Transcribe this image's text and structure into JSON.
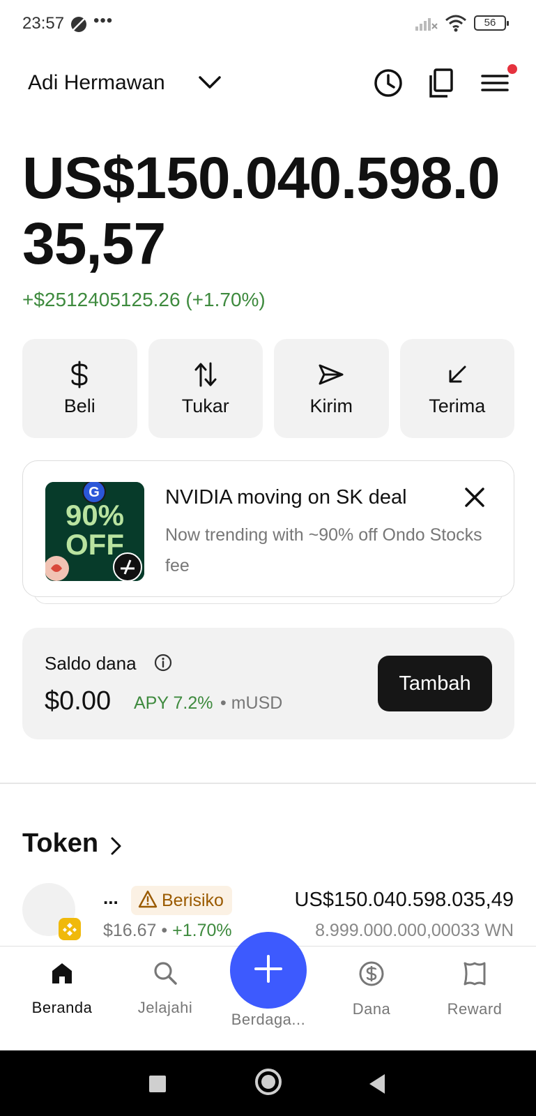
{
  "status_bar": {
    "time": "23:57",
    "extra": "•••",
    "battery": "56"
  },
  "header": {
    "account_name": "Adi Hermawan"
  },
  "portfolio": {
    "balance": "US$150.040.598.035,57",
    "change": "+$2512405125.26 (+1.70%)"
  },
  "actions": [
    {
      "label": "Beli",
      "icon": "dollar-icon"
    },
    {
      "label": "Tukar",
      "icon": "swap-icon"
    },
    {
      "label": "Kirim",
      "icon": "send-icon"
    },
    {
      "label": "Terima",
      "icon": "receive-icon"
    }
  ],
  "promo": {
    "image_text_1": "90%",
    "image_text_2": "OFF",
    "title": "NVIDIA moving on SK deal",
    "description": "Now trending with ~90% off Ondo Stocks fee"
  },
  "savings": {
    "label": "Saldo dana",
    "amount": "$0.00",
    "apy": "APY 7.2%",
    "asset": "• mUSD",
    "add_label": "Tambah"
  },
  "tokens": {
    "heading": "Token",
    "items": [
      {
        "name": "...",
        "risk_label": "Berisiko",
        "value": "US$150.040.598.035,49",
        "price": "$16.67 •",
        "price_change": "+1.70%",
        "amount": "8.999.000.000,00033 WN"
      }
    ]
  },
  "bottom_nav": {
    "items": [
      {
        "label": "Beranda",
        "icon": "home-icon",
        "active": true
      },
      {
        "label": "Jelajahi",
        "icon": "search-icon"
      },
      {
        "label": "Berdaga...",
        "icon": "plus-icon"
      },
      {
        "label": "Dana",
        "icon": "dollar-circle-icon"
      },
      {
        "label": "Reward",
        "icon": "reward-icon"
      }
    ]
  },
  "colors": {
    "positive": "#3e8a3e",
    "fab": "#3d5afe",
    "risk_text": "#9a5a00",
    "risk_bg": "#fbf1e4",
    "notification_dot": "#e5323e"
  }
}
